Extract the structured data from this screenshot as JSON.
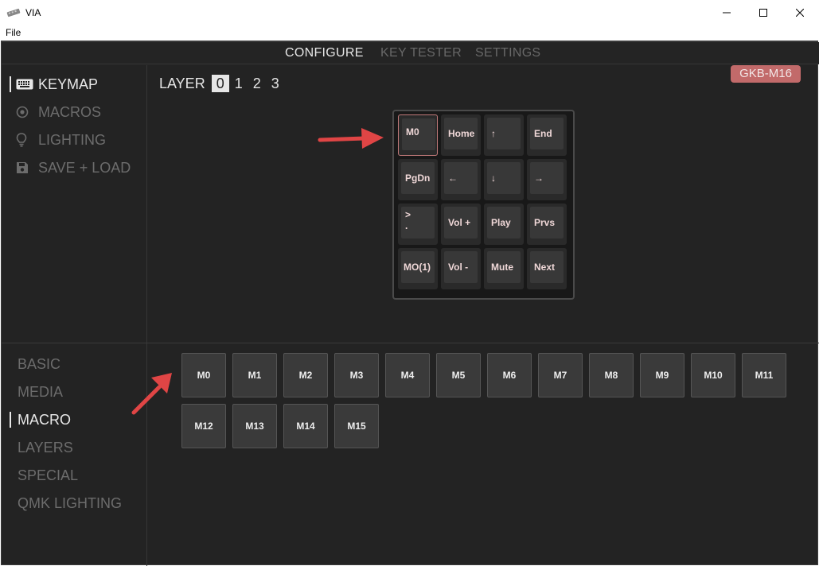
{
  "window": {
    "title": "VIA",
    "menu_file": "File"
  },
  "top_nav": {
    "configure": "CONFIGURE",
    "key_tester": "KEY TESTER",
    "settings": "SETTINGS"
  },
  "sidebar": {
    "keymap": "KEYMAP",
    "macros": "MACROS",
    "lighting": "LIGHTING",
    "save_load": "SAVE + LOAD"
  },
  "layers": {
    "label": "LAYER",
    "items": [
      "0",
      "1",
      "2",
      "3"
    ],
    "active": "0"
  },
  "device_badge": "GKB-M16",
  "keymap_keys": [
    [
      "M0",
      "Home",
      "↑",
      "End"
    ],
    [
      "PgDn",
      "←",
      "↓",
      "→"
    ],
    [
      ">\n.",
      "Vol +",
      "Play",
      "Prvs"
    ],
    [
      "MO(1)",
      "Vol -",
      "Mute",
      "Next"
    ]
  ],
  "categories": {
    "basic": "BASIC",
    "media": "MEDIA",
    "macro": "MACRO",
    "layers": "LAYERS",
    "special": "SPECIAL",
    "qmk_lighting": "QMK LIGHTING"
  },
  "macro_keys": [
    "M0",
    "M1",
    "M2",
    "M3",
    "M4",
    "M5",
    "M6",
    "M7",
    "M8",
    "M9",
    "M10",
    "M11",
    "M12",
    "M13",
    "M14",
    "M15"
  ],
  "colors": {
    "accent": "#c26a6a",
    "background": "#232323",
    "arrow": "#e04545"
  }
}
